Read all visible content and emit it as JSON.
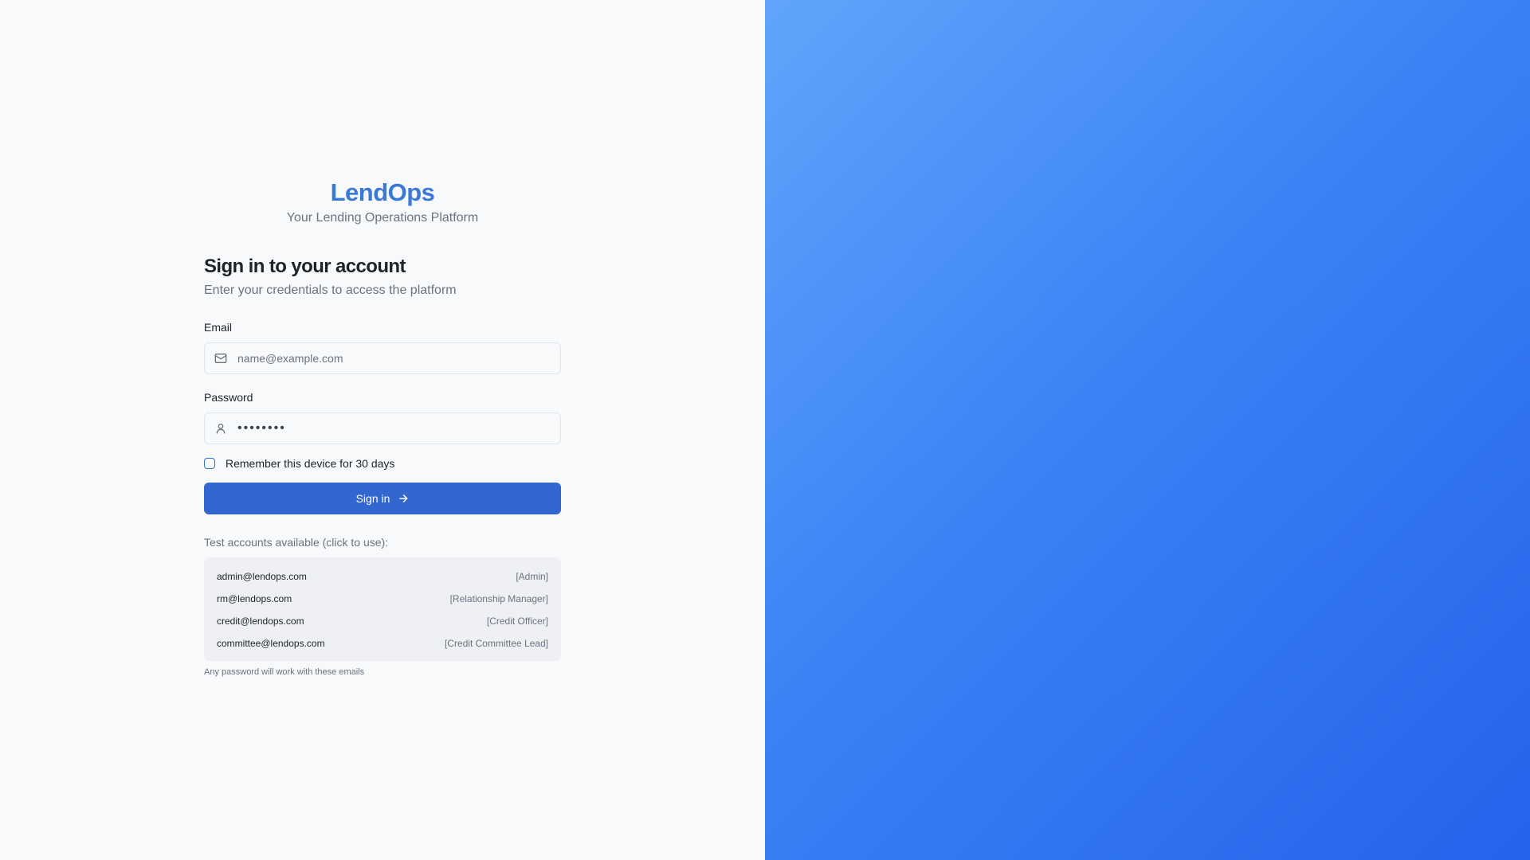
{
  "brand": {
    "logo": "LendOps",
    "tagline": "Your Lending Operations Platform"
  },
  "form": {
    "heading": "Sign in to your account",
    "subheading": "Enter your credentials to access the platform",
    "email_label": "Email",
    "email_placeholder": "name@example.com",
    "email_value": "",
    "password_label": "Password",
    "password_value": "••••••••",
    "remember_label": "Remember this device for 30 days",
    "remember_checked": false,
    "signin_label": "Sign in"
  },
  "test_accounts": {
    "title": "Test accounts available (click to use):",
    "items": [
      {
        "email": "admin@lendops.com",
        "role": "[Admin]"
      },
      {
        "email": "rm@lendops.com",
        "role": "[Relationship Manager]"
      },
      {
        "email": "credit@lendops.com",
        "role": "[Credit Officer]"
      },
      {
        "email": "committee@lendops.com",
        "role": "[Credit Committee Lead]"
      }
    ],
    "footnote": "Any password will work with these emails"
  },
  "icons": {
    "email": "mail-icon",
    "password": "user-icon",
    "signin": "arrow-right-icon"
  },
  "colors": {
    "brand": "#3b78d8",
    "button": "#3267d0",
    "gradient_start": "#60a5fa",
    "gradient_end": "#2563eb"
  }
}
